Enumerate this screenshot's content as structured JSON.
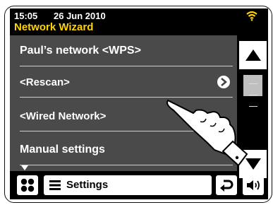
{
  "status": {
    "time": "15:05",
    "date": "26 Jun 2010",
    "wifi_icon": "wifi-icon",
    "accent_color": "#ffd400"
  },
  "header": {
    "title": "Network Wizard"
  },
  "menu": {
    "items": [
      {
        "label": "Paul’s network <WPS>"
      },
      {
        "label": "<Rescan>",
        "icon": "chevron-right-icon"
      },
      {
        "label": "<Wired Network>"
      },
      {
        "label": "Manual settings"
      }
    ]
  },
  "bottom_bar": {
    "settings_label": "Settings"
  }
}
